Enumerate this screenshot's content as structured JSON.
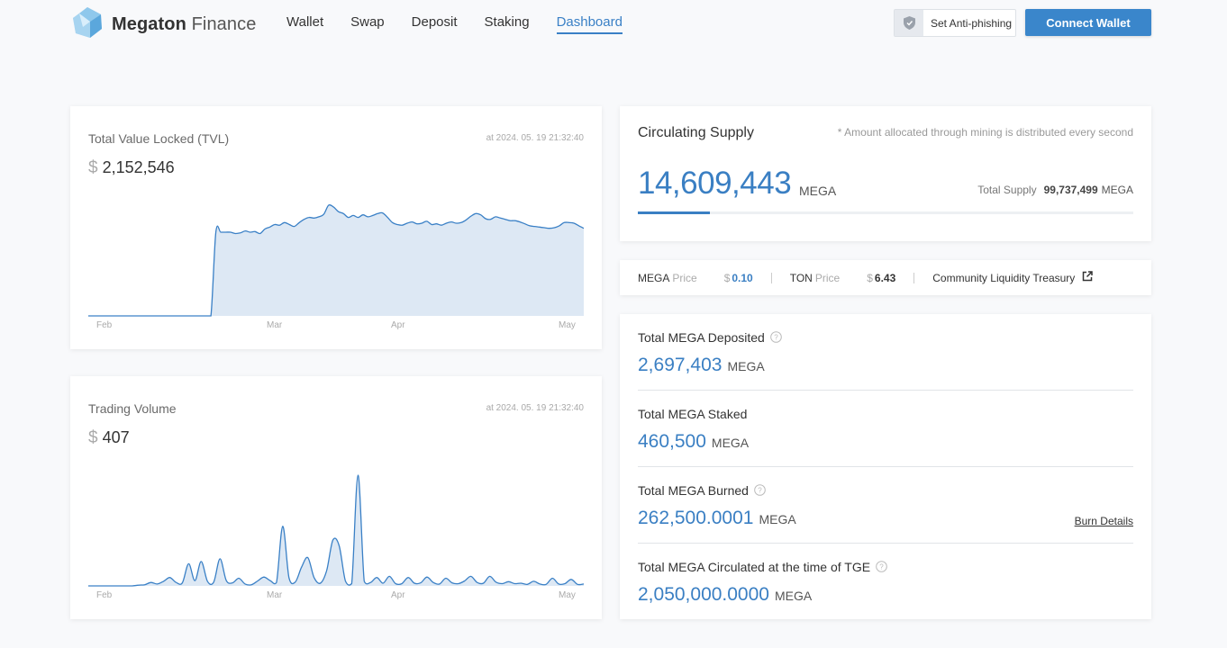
{
  "brand": {
    "bold": "Megaton",
    "light": "Finance"
  },
  "nav": [
    {
      "label": "Wallet"
    },
    {
      "label": "Swap"
    },
    {
      "label": "Deposit"
    },
    {
      "label": "Staking"
    },
    {
      "label": "Dashboard",
      "active": true
    }
  ],
  "header": {
    "anti_phishing": "Set Anti-phishing",
    "connect": "Connect Wallet"
  },
  "tvl": {
    "title": "Total Value Locked (TVL)",
    "timestamp": "at 2024. 05. 19 21:32:40",
    "currency": "$",
    "value": "2,152,546",
    "x_labels": [
      "Feb",
      "Mar",
      "Apr",
      "May"
    ]
  },
  "volume": {
    "title": "Trading Volume",
    "timestamp": "at 2024. 05. 19 21:32:40",
    "currency": "$",
    "value": "407",
    "x_labels": [
      "Feb",
      "Mar",
      "Apr",
      "May"
    ]
  },
  "supply": {
    "title": "Circulating Supply",
    "note": "* Amount allocated through mining is distributed every second",
    "value": "14,609,443",
    "unit": "MEGA",
    "total_label": "Total Supply",
    "total_value": "99,737,499",
    "total_unit": "MEGA",
    "progress_fraction": 0.146
  },
  "prices": {
    "mega_label": "MEGA",
    "mega_suffix": "Price",
    "mega_currency": "$",
    "mega_value": "0.10",
    "ton_label": "TON",
    "ton_suffix": "Price",
    "ton_currency": "$",
    "ton_value": "6.43",
    "treasury": "Community Liquidity Treasury"
  },
  "stats": [
    {
      "label": "Total MEGA Deposited",
      "value": "2,697,403",
      "unit": "MEGA",
      "help": true
    },
    {
      "label": "Total MEGA Staked",
      "value": "460,500",
      "unit": "MEGA",
      "help": false
    },
    {
      "label": "Total MEGA Burned",
      "value": "262,500.0001",
      "unit": "MEGA",
      "help": true,
      "link": "Burn Details"
    },
    {
      "label": "Total MEGA Circulated at the time of TGE",
      "value": "2,050,000.0000",
      "unit": "MEGA",
      "help": true
    }
  ],
  "colors": {
    "accent": "#3a80c6",
    "area_fill": "#dde8f4"
  },
  "chart_data": [
    {
      "type": "area",
      "title": "Total Value Locked (TVL)",
      "x_tick_labels": [
        "Feb",
        "Mar",
        "Apr",
        "May"
      ],
      "series_values": [
        0,
        0,
        0,
        0,
        0,
        0,
        0,
        0,
        0,
        0,
        0,
        0,
        0,
        0,
        0,
        0,
        0,
        0,
        0,
        0,
        0,
        0,
        0,
        0,
        0,
        0,
        1300000,
        1300000,
        1300000,
        1300000,
        1280000,
        1290000,
        1320000,
        1300000,
        1310000,
        1280000,
        1350000,
        1380000,
        1420000,
        1410000,
        1450000,
        1420000,
        1390000,
        1450000,
        1500000,
        1530000,
        1520000,
        1540000,
        1580000,
        1720000,
        1690000,
        1620000,
        1590000,
        1530000,
        1560000,
        1530000,
        1570000,
        1540000,
        1560000,
        1590000,
        1600000,
        1530000,
        1450000,
        1420000,
        1410000,
        1440000,
        1460000,
        1430000,
        1440000,
        1470000,
        1420000,
        1430000,
        1410000,
        1440000,
        1460000,
        1440000,
        1450000,
        1490000,
        1550000,
        1590000,
        1570000,
        1510000,
        1500000,
        1540000,
        1520000,
        1500000,
        1480000,
        1480000,
        1460000,
        1430000,
        1400000,
        1390000,
        1380000,
        1370000,
        1360000,
        1370000,
        1400000,
        1450000,
        1450000,
        1440000,
        1400000,
        1360000
      ]
    },
    {
      "type": "area",
      "title": "Trading Volume",
      "x_tick_labels": [
        "Feb",
        "Mar",
        "Apr",
        "May"
      ],
      "series_values": [
        0,
        0,
        0,
        0,
        0,
        0,
        0,
        0,
        200,
        300,
        900,
        500,
        1200,
        2200,
        900,
        800,
        5800,
        1400,
        6400,
        1200,
        1000,
        7100,
        1400,
        800,
        2000,
        500,
        300,
        1300,
        2300,
        1400,
        900,
        15600,
        2100,
        1000,
        4900,
        7400,
        2200,
        700,
        4000,
        12000,
        10500,
        1300,
        600,
        29000,
        1200,
        900,
        2200,
        700,
        2500,
        600,
        600,
        2200,
        700,
        800,
        2300,
        900,
        500,
        2000,
        800,
        600,
        1300,
        2500,
        900,
        700,
        2500,
        1000,
        600,
        1100,
        600,
        700,
        400,
        1200,
        500,
        400,
        2000,
        500,
        600,
        1700,
        400,
        500
      ]
    }
  ]
}
